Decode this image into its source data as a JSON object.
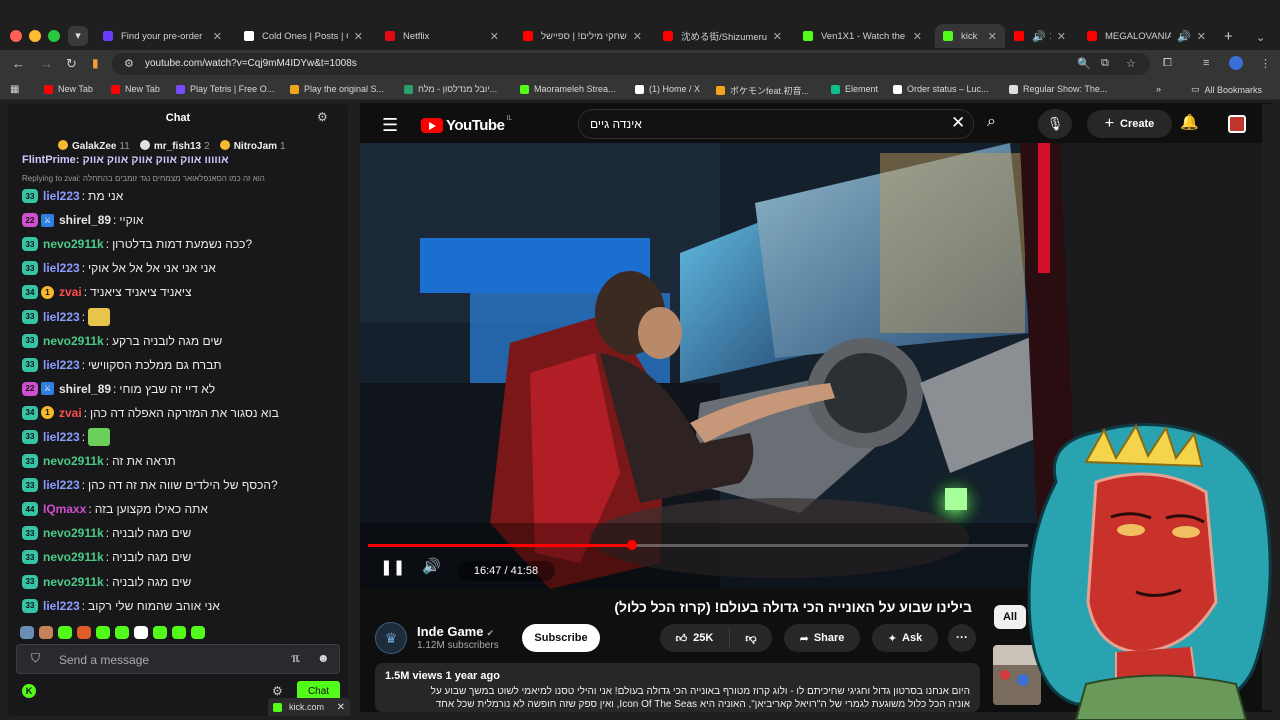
{
  "browser": {
    "tabs": [
      {
        "label": "Find your pre-order",
        "color": "#6b3cff",
        "active": false
      },
      {
        "label": "Cold Ones | Posts | C",
        "color": "#ffffff",
        "active": false
      },
      {
        "label": "Netflix",
        "color": "#e50914",
        "active": false
      },
      {
        "label": "משחקי מילים! | ספיישל",
        "color": "#ff0000",
        "active": false
      },
      {
        "label": "沈める街/Shizumeru",
        "color": "#ff0000",
        "active": false
      },
      {
        "label": "Ven1X1 - Watch the",
        "color": "#53fc18",
        "active": false
      },
      {
        "label": "kick",
        "color": "#53fc18",
        "active": true
      },
      {
        "label": "ב",
        "color": "#ff0000",
        "active": false
      },
      {
        "label": "MEGALOVANIA",
        "color": "#ff0000",
        "active": false
      }
    ],
    "url": "youtube.com/watch?v=Cqj9mM4IDYw&t=1008s",
    "bookmarks": [
      {
        "label": "New Tab",
        "color": "#ff0000"
      },
      {
        "label": "New Tab",
        "color": "#ff0000"
      },
      {
        "label": "Play Tetris | Free O...",
        "color": "#7a4cff"
      },
      {
        "label": "Play the original S...",
        "color": "#f2a61c"
      },
      {
        "label": "יובל מנדלסון - מלח...",
        "color": "#2b9e6b"
      },
      {
        "label": "Maorameleh Strea...",
        "color": "#53fc18"
      },
      {
        "label": "(1) Home / X",
        "color": "#ffffff"
      },
      {
        "label": "ポケモンfeat.初音...",
        "color": "#f2a61c"
      },
      {
        "label": "Element",
        "color": "#0dbd8b"
      },
      {
        "label": "Order status – Luc...",
        "color": "#ffffff"
      },
      {
        "label": "Regular Show: The...",
        "color": "#dddddd"
      }
    ],
    "all_bookmarks": "All Bookmarks",
    "bottom_tab": "kick.com"
  },
  "chat": {
    "title": "Chat",
    "pinned": [
      {
        "name": "GalakZee",
        "count": "11",
        "color": "#f5b82e"
      },
      {
        "name": "mr_fish13",
        "count": "2",
        "color": "#e0e0e0"
      },
      {
        "name": "NitroJam",
        "count": "1",
        "color": "#f5b82e"
      }
    ],
    "clipped_message": "FlintPrime: אווווו אווק אווק אווק אווק אווק",
    "reply_note": "Replying to zvai: הוא זה כמו הסאנפלאואר מצמחים נגד זומבים בהתחלה",
    "messages": [
      {
        "level": "33",
        "level_color": "#37c4a4",
        "user": "liel223",
        "user_color": "#8e9cff",
        "text": "אני מת"
      },
      {
        "level": "22",
        "level_color": "#d04fcf",
        "badge": "sword",
        "user": "shirel_89",
        "user_color": "#e6e6e6",
        "text": "אוקיי"
      },
      {
        "level": "33",
        "level_color": "#37c4a4",
        "user": "nevo2911k",
        "user_color": "#4ccb87",
        "text": "?ככה נשמעת דמות בדלטרון"
      },
      {
        "level": "33",
        "level_color": "#37c4a4",
        "user": "liel223",
        "user_color": "#8e9cff",
        "text": "אני אני אני אל אל אל אוקי"
      },
      {
        "level": "34",
        "level_color": "#37c4a4",
        "badge": "1",
        "user": "zvai",
        "user_color": "#ff4d4d",
        "text": "ציאניד ציאניד ציאניד"
      },
      {
        "level": "33",
        "level_color": "#37c4a4",
        "user": "liel223",
        "user_color": "#8e9cff",
        "text": "",
        "emote": "#e8c44a"
      },
      {
        "level": "33",
        "level_color": "#37c4a4",
        "user": "nevo2911k",
        "user_color": "#4ccb87",
        "text": "שים מגה לובניה ברקע"
      },
      {
        "level": "33",
        "level_color": "#37c4a4",
        "user": "liel223",
        "user_color": "#8e9cff",
        "text": "תברח גם ממלכת הסקווישי"
      },
      {
        "level": "22",
        "level_color": "#d04fcf",
        "badge": "sword",
        "user": "shirel_89",
        "user_color": "#e6e6e6",
        "text": "לא דיי זה שבץ מוחי"
      },
      {
        "level": "34",
        "level_color": "#37c4a4",
        "badge": "1",
        "user": "zvai",
        "user_color": "#ff4d4d",
        "text": "בוא נסגור את המזרקה האפלה דה כהן"
      },
      {
        "level": "33",
        "level_color": "#37c4a4",
        "user": "liel223",
        "user_color": "#8e9cff",
        "text": "",
        "emote": "#6bcf5a"
      },
      {
        "level": "33",
        "level_color": "#37c4a4",
        "user": "nevo2911k",
        "user_color": "#4ccb87",
        "text": "תראה את זה"
      },
      {
        "level": "33",
        "level_color": "#37c4a4",
        "user": "liel223",
        "user_color": "#8e9cff",
        "text": "?הכסף של הילדים שווה את זה דה כהן"
      },
      {
        "level": "44",
        "level_color": "#37c4a4",
        "user": "IQmaxx",
        "user_color": "#d04fcf",
        "text": "אתה כאילו מקצוען בזה"
      },
      {
        "level": "33",
        "level_color": "#37c4a4",
        "user": "nevo2911k",
        "user_color": "#4ccb87",
        "text": "שים מגה לובניה"
      },
      {
        "level": "33",
        "level_color": "#37c4a4",
        "user": "nevo2911k",
        "user_color": "#4ccb87",
        "text": "שים מגה לובניה"
      },
      {
        "level": "33",
        "level_color": "#37c4a4",
        "user": "nevo2911k",
        "user_color": "#4ccb87",
        "text": "שים מגה לובניה"
      },
      {
        "level": "33",
        "level_color": "#37c4a4",
        "user": "liel223",
        "user_color": "#8e9cff",
        "text": "אני אוהב שהמוח שלי רקוב"
      }
    ],
    "emote_bar": [
      "#6a8fb5",
      "#c9815a",
      "#53fc18",
      "#e05b2c",
      "#53fc18",
      "#53fc18",
      "#ffffff",
      "#53fc18",
      "#53fc18",
      "#53fc18"
    ],
    "input_placeholder": "Send a message",
    "send_button": "Chat"
  },
  "youtube": {
    "search_value": "אינדה גיים",
    "create_label": "Create",
    "video": {
      "time": "16:47 / 41:58",
      "progress": 0.4
    },
    "title": "בילינו שבוע על האונייה הכי גדולה בעולם! (קרוז הכל כלול)",
    "channel": {
      "name": "Inde Game",
      "subs": "1.12M subscribers"
    },
    "subscribe_label": "Subscribe",
    "likes": "25K",
    "share_label": "Share",
    "ask_label": "Ask",
    "desc": {
      "meta": "1.5M views  1 year ago",
      "line1": "היום אנחנו בסרטון גדול וחגיגי שחיכיתם לו - ולוג קרוז מטורף באונייה הכי גדולה בעולם! אני והילי טסנו למיאמי לשוט במשך שבוע על",
      "line2": "אוניה הכל כלול משוגעת לגמרי של ה\"רויאל קאריביאן\", האוניה היא Icon Of The Seas, ואין ספק שזה חופשה לא נורמלית שכל אחד"
    },
    "chip_all": "All"
  }
}
